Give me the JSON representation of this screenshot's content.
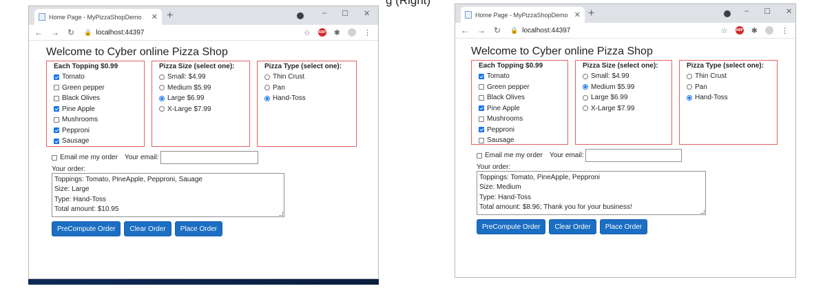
{
  "caption": "g (Right)",
  "colors": {
    "accent": "#1b6ec2",
    "panel_border": "#e06060",
    "taskbar": "#1d3a6e"
  },
  "icons": [
    "favicon-icon",
    "close-icon",
    "plus-icon",
    "back-icon",
    "forward-icon",
    "reload-icon",
    "lock-icon",
    "star-icon",
    "adblock-icon",
    "extensions-icon",
    "profile-icon",
    "more-icon",
    "minimize-icon",
    "maximize-icon",
    "chevron-down-icon"
  ],
  "left": {
    "tab_title": "Home Page - MyPizzaShopDemo",
    "url": "localhost:44397",
    "window_controls": {
      "minimize": "–",
      "maximize": "☐",
      "close": "✕"
    },
    "heading": "Welcome to Cyber online Pizza Shop",
    "toppings": {
      "header": "Each Topping $0.99",
      "items": [
        {
          "label": "Tomato",
          "checked": true
        },
        {
          "label": "Green pepper",
          "checked": false
        },
        {
          "label": "Black Olives",
          "checked": false
        },
        {
          "label": "Pine Apple",
          "checked": true
        },
        {
          "label": "Mushrooms",
          "checked": false
        },
        {
          "label": "Pepproni",
          "checked": true
        },
        {
          "label": "Sausage",
          "checked": true
        }
      ]
    },
    "sizes": {
      "header": "Pizza Size (select one):",
      "items": [
        {
          "label": "Small: $4.99",
          "selected": false
        },
        {
          "label": "Medium $5.99",
          "selected": false
        },
        {
          "label": "Large $6.99",
          "selected": true
        },
        {
          "label": "X-Large $7.99",
          "selected": false
        }
      ]
    },
    "types": {
      "header": "Pizza Type (select one):",
      "items": [
        {
          "label": "Thin Crust",
          "selected": false
        },
        {
          "label": "Pan",
          "selected": false
        },
        {
          "label": "Hand-Toss",
          "selected": true
        }
      ]
    },
    "email_label": "Email me my order",
    "email_checked": false,
    "your_email_label": "Your email:",
    "email_value": "",
    "order_label": "Your order:",
    "order_lines": [
      "Toppings: Tomato, PineApple, Pepproni, Sauage",
      "Size: Large",
      "Type: Hand-Toss",
      "Total amount: $10.95"
    ],
    "buttons": {
      "precompute": "PreCompute Order",
      "clear": "Clear Order",
      "place": "Place Order"
    }
  },
  "right": {
    "tab_title": "Home Page - MyPizzaShopDemo",
    "url": "localhost:44397",
    "window_controls": {
      "minimize": "–",
      "maximize": "☐",
      "close": "✕"
    },
    "heading": "Welcome to Cyber online Pizza Shop",
    "toppings": {
      "header": "Each Topping $0.99",
      "items": [
        {
          "label": "Tomato",
          "checked": true
        },
        {
          "label": "Green pepper",
          "checked": false
        },
        {
          "label": "Black Olives",
          "checked": false
        },
        {
          "label": "Pine Apple",
          "checked": true
        },
        {
          "label": "Mushrooms",
          "checked": false
        },
        {
          "label": "Pepproni",
          "checked": true
        },
        {
          "label": "Sausage",
          "checked": false
        }
      ]
    },
    "sizes": {
      "header": "Pizza Size (select one):",
      "items": [
        {
          "label": "Small: $4.99",
          "selected": false
        },
        {
          "label": "Medium $5.99",
          "selected": true
        },
        {
          "label": "Large $6.99",
          "selected": false
        },
        {
          "label": "X-Large $7.99",
          "selected": false
        }
      ]
    },
    "types": {
      "header": "Pizza Type (select one):",
      "items": [
        {
          "label": "Thin Crust",
          "selected": false
        },
        {
          "label": "Pan",
          "selected": false
        },
        {
          "label": "Hand-Toss",
          "selected": true
        }
      ]
    },
    "email_label": "Email me my order",
    "email_checked": false,
    "your_email_label": "Your email:",
    "email_value": "",
    "order_label": "Your order:",
    "order_lines": [
      "Toppings: Tomato, PineApple, Pepproni",
      "Size: Medium",
      "Type: Hand-Toss",
      "Total amount: $8.96; Thank you for your business!"
    ],
    "buttons": {
      "precompute": "PreCompute Order",
      "clear": "Clear Order",
      "place": "Place Order"
    }
  }
}
